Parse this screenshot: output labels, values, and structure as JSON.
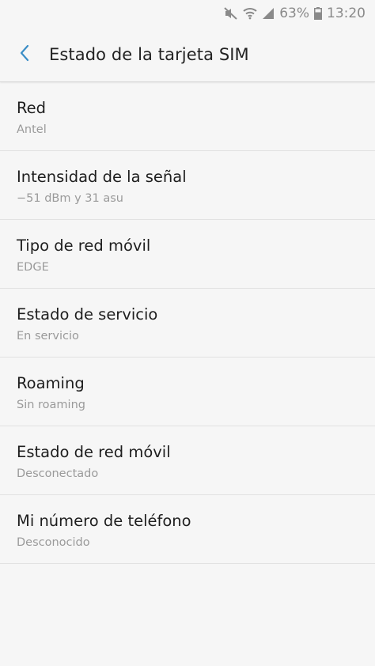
{
  "status_bar": {
    "battery_percent": "63%",
    "time": "13:20",
    "icons": [
      "mute-icon",
      "wifi-icon",
      "signal-icon",
      "battery-icon"
    ]
  },
  "app_bar": {
    "title": "Estado de la tarjeta SIM",
    "back_icon": "chevron-left-icon"
  },
  "colors": {
    "accent": "#3b8ec6",
    "background": "#f6f6f6",
    "secondary_text": "#9a9a9a"
  },
  "items": [
    {
      "title": "Red",
      "value": "Antel"
    },
    {
      "title": "Intensidad de la señal",
      "value": "−51 dBm y 31 asu"
    },
    {
      "title": "Tipo de red móvil",
      "value": "EDGE"
    },
    {
      "title": "Estado de servicio",
      "value": "En servicio"
    },
    {
      "title": "Roaming",
      "value": "Sin roaming"
    },
    {
      "title": "Estado de red móvil",
      "value": "Desconectado"
    },
    {
      "title": "Mi número de teléfono",
      "value": "Desconocido"
    }
  ]
}
